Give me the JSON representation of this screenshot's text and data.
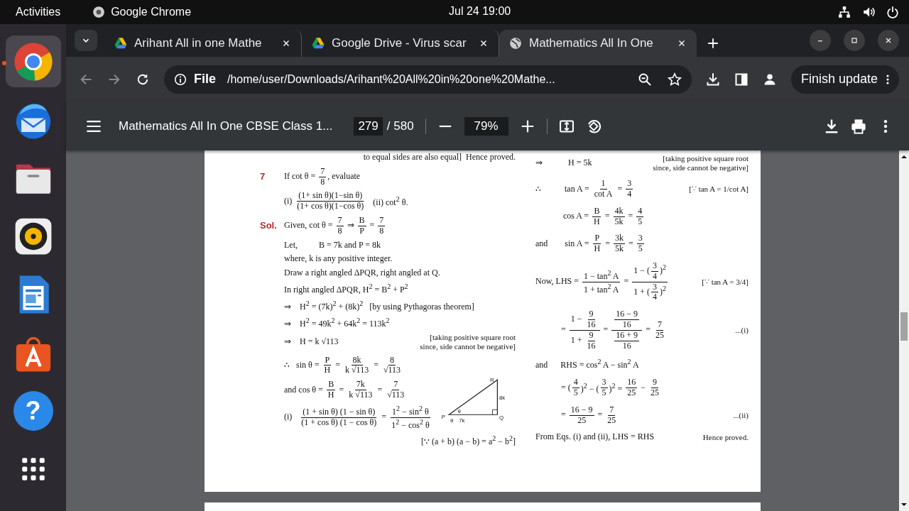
{
  "topbar": {
    "activities": "Activities",
    "app": "Google Chrome",
    "clock": "Jul 24  19:00"
  },
  "dock": [
    {
      "kind": "chrome",
      "running": true
    },
    {
      "kind": "mail",
      "running": false
    },
    {
      "kind": "files",
      "running": false
    },
    {
      "kind": "music",
      "running": false
    },
    {
      "kind": "writer",
      "running": false
    },
    {
      "kind": "store",
      "running": false
    },
    {
      "kind": "help",
      "running": false,
      "glyph": "?"
    },
    {
      "kind": "grid",
      "running": false
    }
  ],
  "tabs": [
    {
      "title": "Arihant All in one Mathe",
      "kind": "drive",
      "selected": false
    },
    {
      "title": "Google Drive - Virus scar",
      "kind": "drive",
      "selected": false
    },
    {
      "title": "Mathematics All In One",
      "kind": "globe",
      "selected": true
    }
  ],
  "address": {
    "scheme": "File",
    "url": "/home/user/Downloads/Arihant%20All%20in%20one%20Mathe..."
  },
  "update_button": "Finish update",
  "pdf_toolbar": {
    "title": "Mathematics All In One CBSE Class 1...",
    "page": "279",
    "page_count": "/ 580",
    "zoom": "79%"
  },
  "page": {
    "left": [
      {
        "segs": [
          {
            "kind": "note",
            "t": "to equal sides are also equal]  Hence proved."
          }
        ]
      },
      {
        "segs": [
          {
            "kind": "label",
            "t": "7"
          },
          {
            "kind": "text",
            "t": "If cot θ = "
          },
          {
            "kind": "frac",
            "n": "7",
            "d": "8"
          },
          {
            "kind": "text",
            "t": ", evaluate"
          }
        ]
      },
      {
        "segs": [
          {
            "kind": "text",
            "t": "(i) "
          },
          {
            "kind": "frac",
            "n": "(1+ sin θ)(1−sin θ)",
            "d": "(1+ cos θ)(1−cos θ)"
          },
          {
            "kind": "text",
            "t": "   (ii) cot$^{2}$ θ."
          }
        ]
      },
      {
        "segs": [
          {
            "kind": "label",
            "t": "Sol."
          },
          {
            "kind": "text",
            "t": "Given, cot θ = "
          },
          {
            "kind": "frac",
            "n": "7",
            "d": "8"
          },
          {
            "kind": "text",
            "t": " ⇒ "
          },
          {
            "kind": "frac",
            "n": "B",
            "d": "P"
          },
          {
            "kind": "text",
            "t": " = "
          },
          {
            "kind": "frac",
            "n": "7",
            "d": "8"
          }
        ]
      },
      {
        "segs": [
          {
            "kind": "text",
            "t": "Let,          B = 7k and P = 8k"
          }
        ]
      },
      {
        "segs": [
          {
            "kind": "text",
            "t": "where, k is any positive integer."
          }
        ]
      },
      {
        "segs": [
          {
            "kind": "text",
            "t": "Draw a right angled ΔPQR, right angled at Q."
          }
        ]
      },
      {
        "segs": [
          {
            "kind": "text",
            "t": "In right angled ΔPQR, H$^{2}$ = B$^{2}$ + P$^{2}$"
          }
        ]
      },
      {
        "segs": [
          {
            "kind": "text",
            "t": "⇒    H$^{2}$ = (7k)$^{2}$ + (8k)$^{2}$   [by using Pythagoras theorem]"
          }
        ]
      },
      {
        "segs": [
          {
            "kind": "text",
            "t": "⇒    H$^{2}$ = 49k$^{2}$ + 64k$^{2}$ = 113k$^{2}$"
          }
        ]
      },
      {
        "segs": [
          {
            "kind": "text",
            "t": "⇒    H = k √113"
          },
          {
            "kind": "note",
            "t": "[taking positive square root since, side cannot be negative]"
          }
        ]
      },
      {
        "segs": [
          {
            "kind": "text",
            "t": "∴   sin θ = "
          },
          {
            "kind": "frac",
            "n": "P",
            "d": "H"
          },
          {
            "kind": "text",
            "t": " = "
          },
          {
            "kind": "frac",
            "n": "8k",
            "d": "k √113"
          },
          {
            "kind": "text",
            "t": " = "
          },
          {
            "kind": "frac",
            "n": "8",
            "d": "√113"
          }
        ]
      },
      {
        "segs": [
          {
            "kind": "text",
            "t": "and cos θ = "
          },
          {
            "kind": "frac",
            "n": "B",
            "d": "H"
          },
          {
            "kind": "text",
            "t": " = "
          },
          {
            "kind": "frac",
            "n": "7k",
            "d": "k √113"
          },
          {
            "kind": "text",
            "t": " = "
          },
          {
            "kind": "frac",
            "n": "7",
            "d": "√113"
          }
        ]
      },
      {
        "segs": [
          {
            "kind": "text",
            "t": "(i)   "
          },
          {
            "kind": "frac",
            "n": "(1 + sin θ) (1 − sin θ)",
            "d": "(1 + cos θ) (1 − cos θ)"
          },
          {
            "kind": "text",
            "t": " = "
          },
          {
            "kind": "frac",
            "n": "1$^{2}$ − sin$^{2}$ θ",
            "d": "1$^{2}$ − cos$^{2}$ θ"
          }
        ]
      },
      {
        "segs": [
          {
            "kind": "note",
            "t": "[∵ (a + b) (a − b) = a$^{2}$ − b$^{2}$]"
          }
        ]
      }
    ],
    "diagram": {
      "top": "R",
      "side": "8k",
      "angle": "θ",
      "left": "P",
      "bottom_angle": "θ",
      "base": "7k",
      "right": "Q"
    },
    "right": [
      {
        "segs": [
          {
            "kind": "text",
            "t": "⇒            H = 5k"
          },
          {
            "kind": "note",
            "t": "[taking positive square root since, side cannot be negative]"
          }
        ]
      },
      {
        "segs": [
          {
            "kind": "text",
            "t": "∴           tan A = "
          },
          {
            "kind": "frac",
            "n": "1",
            "d": "cot A"
          },
          {
            "kind": "text",
            "t": " = "
          },
          {
            "kind": "frac",
            "n": "3",
            "d": "4"
          },
          {
            "kind": "note",
            "t": "[∵ tan A = 1/cot A]"
          }
        ]
      },
      {
        "segs": [
          {
            "kind": "text",
            "t": "             cos A = "
          },
          {
            "kind": "frac",
            "n": "B",
            "d": "H"
          },
          {
            "kind": "text",
            "t": " = "
          },
          {
            "kind": "frac",
            "n": "4k",
            "d": "5k"
          },
          {
            "kind": "text",
            "t": " = "
          },
          {
            "kind": "frac",
            "n": "4",
            "d": "5"
          }
        ]
      },
      {
        "segs": [
          {
            "kind": "text",
            "t": "and        sin A = "
          },
          {
            "kind": "frac",
            "n": "P",
            "d": "H"
          },
          {
            "kind": "text",
            "t": " = "
          },
          {
            "kind": "frac",
            "n": "3k",
            "d": "5k"
          },
          {
            "kind": "text",
            "t": " = "
          },
          {
            "kind": "frac",
            "n": "3",
            "d": "5"
          }
        ]
      },
      {
        "segs": [
          {
            "kind": "text",
            "t": "Now, LHS = "
          },
          {
            "kind": "frac",
            "n": "1 − tan$^{2}$ A",
            "d": "1 + tan$^{2}$ A"
          },
          {
            "kind": "text",
            "t": " = "
          },
          {
            "kind": "frac",
            "n": [
              {
                "kind": "text",
                "t": "1 − ("
              },
              {
                "kind": "frac",
                "n": "3",
                "d": "4"
              },
              {
                "kind": "text",
                "t": ")$^{2}$"
              }
            ],
            "d": [
              {
                "kind": "text",
                "t": "1 + ("
              },
              {
                "kind": "frac",
                "n": "3",
                "d": "4"
              },
              {
                "kind": "text",
                "t": ")$^{2}$"
              }
            ]
          },
          {
            "kind": "note",
            "t": "[∵ tan A = 3/4]"
          }
        ]
      },
      {
        "segs": [
          {
            "kind": "text",
            "t": "            = "
          },
          {
            "kind": "frac",
            "n": [
              {
                "kind": "text",
                "t": "1 − "
              },
              {
                "kind": "frac",
                "n": "9",
                "d": "16"
              }
            ],
            "d": [
              {
                "kind": "text",
                "t": "1 + "
              },
              {
                "kind": "frac",
                "n": "9",
                "d": "16"
              }
            ]
          },
          {
            "kind": "text",
            "t": " = "
          },
          {
            "kind": "frac",
            "n": [
              {
                "kind": "frac",
                "n": "16 − 9",
                "d": "16"
              }
            ],
            "d": [
              {
                "kind": "frac",
                "n": "16 + 9",
                "d": "16"
              }
            ]
          },
          {
            "kind": "text",
            "t": " = "
          },
          {
            "kind": "frac",
            "n": "7",
            "d": "25"
          },
          {
            "kind": "note",
            "t": "...(i)"
          }
        ]
      },
      {
        "segs": [
          {
            "kind": "text",
            "t": "and      RHS = cos$^{2}$ A − sin$^{2}$ A"
          }
        ]
      },
      {
        "segs": [
          {
            "kind": "text",
            "t": "            = ("
          },
          {
            "kind": "frac",
            "n": "4",
            "d": "5"
          },
          {
            "kind": "text",
            "t": ")$^{2}$ − ("
          },
          {
            "kind": "frac",
            "n": "3",
            "d": "5"
          },
          {
            "kind": "text",
            "t": ")$^{2}$ = "
          },
          {
            "kind": "frac",
            "n": "16",
            "d": "25"
          },
          {
            "kind": "text",
            "t": " − "
          },
          {
            "kind": "frac",
            "n": "9",
            "d": "25"
          }
        ]
      },
      {
        "segs": [
          {
            "kind": "text",
            "t": "            = "
          },
          {
            "kind": "frac",
            "n": "16 − 9",
            "d": "25"
          },
          {
            "kind": "text",
            "t": " = "
          },
          {
            "kind": "frac",
            "n": "7",
            "d": "25"
          },
          {
            "kind": "note",
            "t": "...(ii)"
          }
        ]
      },
      {
        "segs": [
          {
            "kind": "text",
            "t": "From Eqs. (i) and (ii), LHS = RHS"
          },
          {
            "kind": "note",
            "t": "Hence proved."
          }
        ]
      }
    ]
  }
}
